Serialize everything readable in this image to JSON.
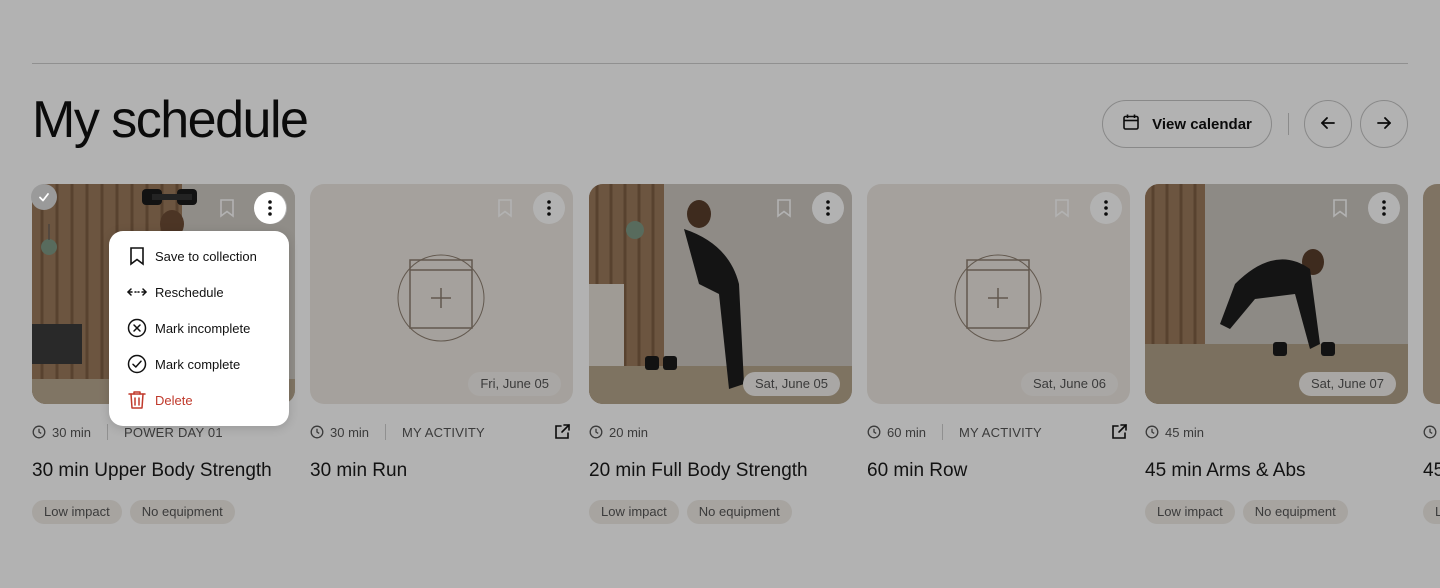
{
  "header": {
    "title": "My schedule",
    "view_calendar_label": "View calendar",
    "icons": {
      "calendar": "calendar-icon",
      "prev": "arrow-left-icon",
      "next": "arrow-right-icon"
    }
  },
  "cards": [
    {
      "duration": "30 min",
      "tag": "POWER DAY 01",
      "title": "30 min Upper Body Strength",
      "chips": [
        "Low impact",
        "No equipment"
      ],
      "date": "",
      "completed": true
    },
    {
      "duration": "30 min",
      "tag": "MY ACTIVITY",
      "title": "30 min Run",
      "chips": [],
      "date": "Fri, June 05",
      "external_link": true
    },
    {
      "duration": "20 min",
      "tag": "",
      "title": "20 min Full Body Strength",
      "chips": [
        "Low impact",
        "No equipment"
      ],
      "date": "Sat, June 05"
    },
    {
      "duration": "60 min",
      "tag": "MY ACTIVITY",
      "title": "60 min Row",
      "chips": [],
      "date": "Sat, June 06",
      "external_link": true
    },
    {
      "duration": "45 min",
      "tag": "",
      "title": "45 min Arms & Abs",
      "chips": [
        "Low impact",
        "No equipment"
      ],
      "date": "Sat, June 07"
    },
    {
      "duration": "",
      "tag": "",
      "title": "45",
      "chips": [
        "L"
      ],
      "date": ""
    }
  ],
  "context_menu": {
    "items": [
      {
        "label": "Save to collection",
        "icon": "bookmark-icon"
      },
      {
        "label": "Reschedule",
        "icon": "arrows-horizontal-icon"
      },
      {
        "label": "Mark incomplete",
        "icon": "x-circle-icon"
      },
      {
        "label": "Mark complete",
        "icon": "check-circle-icon"
      },
      {
        "label": "Delete",
        "icon": "trash-icon",
        "danger": true
      }
    ]
  },
  "colors": {
    "overlay": "rgba(0,0,0,0.30)",
    "delete": "#c0392b",
    "card_placeholder": "#ece7e1",
    "chip_bg": "#efebe6"
  }
}
